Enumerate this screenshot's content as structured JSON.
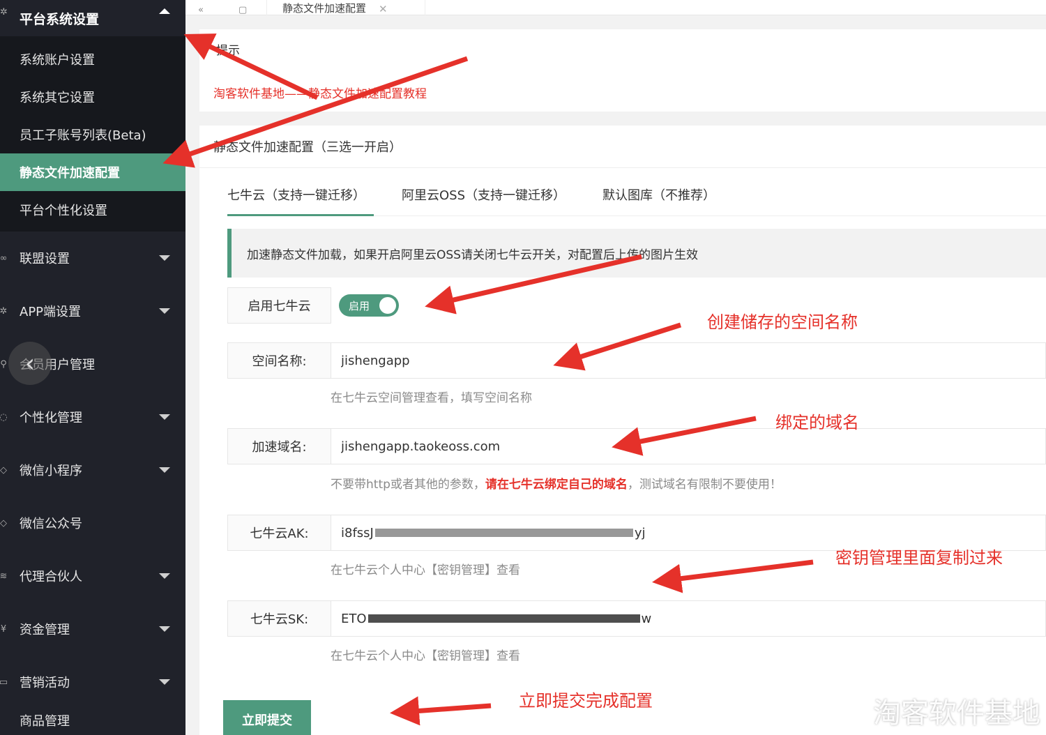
{
  "sidebar": {
    "group_title": "平台系统设置",
    "sub_items": [
      {
        "label": "系统账户设置"
      },
      {
        "label": "系统其它设置"
      },
      {
        "label": "员工子账号列表(Beta)"
      },
      {
        "label": "静态文件加速配置"
      },
      {
        "label": "平台个性化设置"
      }
    ],
    "nav_items": [
      {
        "label": "联盟设置"
      },
      {
        "label": "APP端设置"
      },
      {
        "label": "会员用户管理"
      },
      {
        "label": "个性化管理"
      },
      {
        "label": "微信小程序"
      },
      {
        "label": "微信公众号"
      },
      {
        "label": "代理合伙人"
      },
      {
        "label": "资金管理"
      },
      {
        "label": "营销活动"
      },
      {
        "label": "商品管理"
      }
    ]
  },
  "topbar": {
    "tab_title": "静态文件加速配置"
  },
  "card1": {
    "title": "提示",
    "help_link": "淘客软件基地——静态文件加速配置教程"
  },
  "card2": {
    "title": "静态文件加速配置（三选一开启）",
    "tabs": [
      {
        "label": "七牛云（支持一键迁移）"
      },
      {
        "label": "阿里云OSS（支持一键迁移）"
      },
      {
        "label": "默认图库（不推荐）"
      }
    ],
    "notice": "加速静态文件加载，如果开启阿里云OSS请关闭七牛云开关，对配置后上传的图片生效"
  },
  "form": {
    "enable_label": "启用七牛云",
    "enable_switch": "启用",
    "bucket_label": "空间名称:",
    "bucket_value": "jishengapp",
    "bucket_help": "在七牛云空间管理查看，填写空间名称",
    "domain_label": "加速域名:",
    "domain_value": "jishengapp.taokeoss.com",
    "domain_help_a": "不要带http或者其他的参数，",
    "domain_help_b": "请在七牛云绑定自己的域名",
    "domain_help_c": "，测试域名有限制不要使用！",
    "ak_label": "七牛云AK:",
    "ak_value": "i8fssJ",
    "ak_value_end": "yj",
    "ak_help": "在七牛云个人中心【密钥管理】查看",
    "sk_label": "七牛云SK:",
    "sk_value": "ETO",
    "sk_value_end": "w",
    "sk_help": "在七牛云个人中心【密钥管理】查看",
    "submit": "立即提交"
  },
  "annotations": {
    "bucket": "创建储存的空间名称",
    "domain": "绑定的域名",
    "keys": "密钥管理里面复制过来",
    "submit": "立即提交完成配置"
  },
  "watermark": "淘客软件基地",
  "colors": {
    "accent": "#4e9a7e",
    "sidebar": "#20222a",
    "annotation": "#e5312a"
  }
}
